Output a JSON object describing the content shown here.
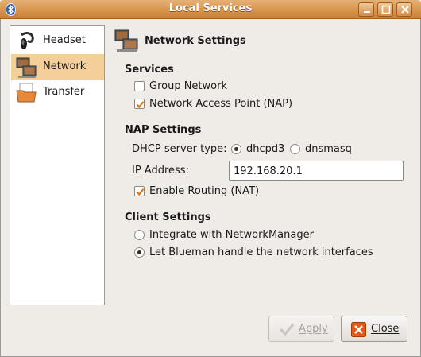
{
  "window": {
    "title": "Local Services"
  },
  "icons": {
    "app": "bluetooth-icon",
    "minimize": "minimize-icon",
    "maximize": "maximize-icon",
    "close": "close-icon"
  },
  "sidebar": {
    "items": [
      {
        "label": "Headset",
        "icon": "headset-icon",
        "selected": false
      },
      {
        "label": "Network",
        "icon": "network-icon",
        "selected": true
      },
      {
        "label": "Transfer",
        "icon": "transfer-folder-icon",
        "selected": false
      }
    ]
  },
  "main": {
    "title": "Network Settings",
    "services": {
      "title": "Services",
      "group_network": {
        "label": "Group Network",
        "checked": false
      },
      "nap": {
        "label": "Network Access Point (NAP)",
        "checked": true
      }
    },
    "nap_settings": {
      "title": "NAP Settings",
      "dhcp_label": "DHCP server type:",
      "dhcp_options": [
        {
          "label": "dhcpd3",
          "selected": true
        },
        {
          "label": "dnsmasq",
          "selected": false
        }
      ],
      "ip_label": "IP Address:",
      "ip_value": "192.168.20.1",
      "routing": {
        "label": "Enable Routing (NAT)",
        "checked": true
      }
    },
    "client_settings": {
      "title": "Client Settings",
      "options": [
        {
          "label": "Integrate with NetworkManager",
          "selected": false
        },
        {
          "label": "Let Blueman handle the network interfaces",
          "selected": true
        }
      ]
    }
  },
  "buttons": {
    "apply": {
      "label": "Apply",
      "enabled": false
    },
    "close": {
      "label": "Close",
      "enabled": true
    }
  },
  "colors": {
    "titlebar": "#d89851",
    "selection": "#f5cf99",
    "window_bg": "#efebe7",
    "check_mark": "#d7781e"
  }
}
